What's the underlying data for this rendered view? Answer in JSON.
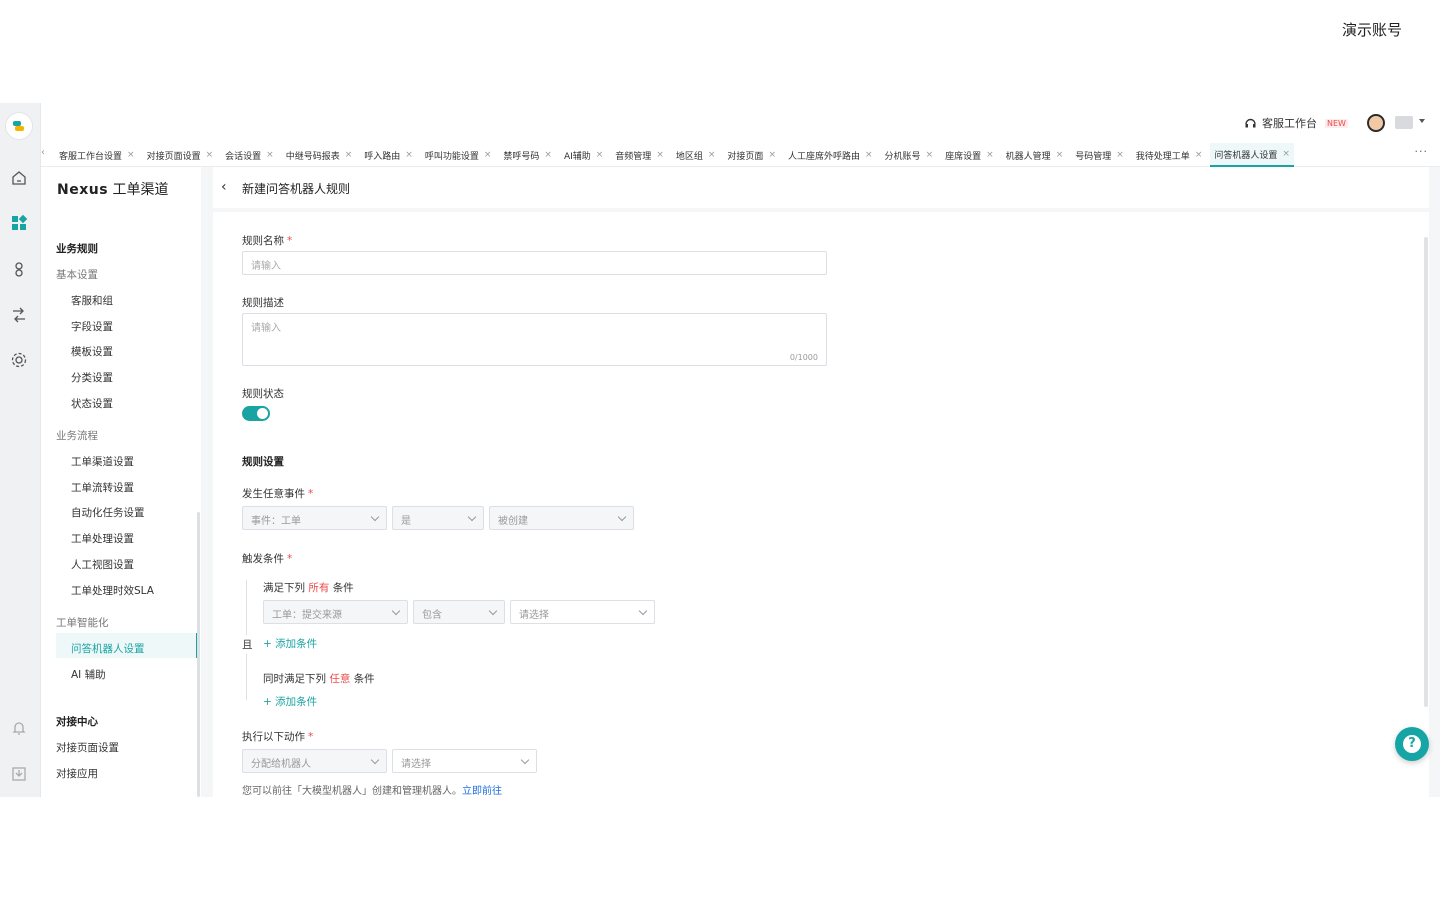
{
  "banner": {
    "account": "演示账号"
  },
  "header": {
    "workspace_label": "客服工作台",
    "new_badge": "NEW"
  },
  "tabs": [
    {
      "label": "客服工作台设置"
    },
    {
      "label": "对接页面设置"
    },
    {
      "label": "会话设置"
    },
    {
      "label": "中继号码报表"
    },
    {
      "label": "呼入路由"
    },
    {
      "label": "呼叫功能设置"
    },
    {
      "label": "禁呼号码"
    },
    {
      "label": "AI辅助"
    },
    {
      "label": "音频管理"
    },
    {
      "label": "地区组"
    },
    {
      "label": "对接页面"
    },
    {
      "label": "人工座席外呼路由"
    },
    {
      "label": "分机账号"
    },
    {
      "label": "座席设置"
    },
    {
      "label": "机器人管理"
    },
    {
      "label": "号码管理"
    },
    {
      "label": "我待处理工单"
    },
    {
      "label": "问答机器人设置",
      "active": true
    }
  ],
  "tab_close": "×",
  "tab_prev": "‹",
  "tab_more": "···",
  "sidebar": {
    "brand": "Nexus",
    "title": "工单渠道",
    "business_rules": "业务规则",
    "basic_settings": "基本设置",
    "basic_items": [
      "客服和组",
      "字段设置",
      "模板设置",
      "分类设置",
      "状态设置"
    ],
    "business_flow": "业务流程",
    "flow_items": [
      "工单渠道设置",
      "工单流转设置",
      "自动化任务设置",
      "工单处理设置",
      "人工视图设置",
      "工单处理时效SLA"
    ],
    "intelligence": "工单智能化",
    "intel_items": [
      "问答机器人设置",
      "AI 辅助"
    ],
    "integration_center": "对接中心",
    "integration_items": [
      "对接页面设置",
      "对接应用"
    ]
  },
  "page": {
    "back": "‹",
    "title": "新建问答机器人规则"
  },
  "form": {
    "rule_name_label": "规则名称",
    "rule_name_placeholder": "请输入",
    "rule_desc_label": "规则描述",
    "rule_desc_placeholder": "请输入",
    "rule_desc_counter": "0/1000",
    "rule_status_label": "规则状态",
    "rule_status_on": true,
    "rule_settings_title": "规则设置",
    "event_label": "发生任意事件",
    "event_selects": [
      "事件：工单",
      "是",
      "被创建"
    ],
    "trigger_label": "触发条件",
    "cond_all_prefix": "满足下列",
    "cond_all_highlight": "所有",
    "cond_suffix": "条件",
    "cond_selects": [
      "工单：提交来源",
      "包含",
      "请选择"
    ],
    "add_condition": "+ 添加条件",
    "and_label": "且",
    "cond_any_prefix": "同时满足下列",
    "cond_any_highlight": "任意",
    "action_label": "执行以下动作",
    "action_selects": [
      "分配给机器人",
      "请选择"
    ],
    "hint_text": "您可以前往「大模型机器人」创建和管理机器人。",
    "hint_link": "立即前往",
    "required_mark": "*"
  },
  "help_glyph": "?",
  "colors": {
    "accent": "#1aa3a3",
    "required": "#e94b4b",
    "link": "#1e6ee0"
  }
}
